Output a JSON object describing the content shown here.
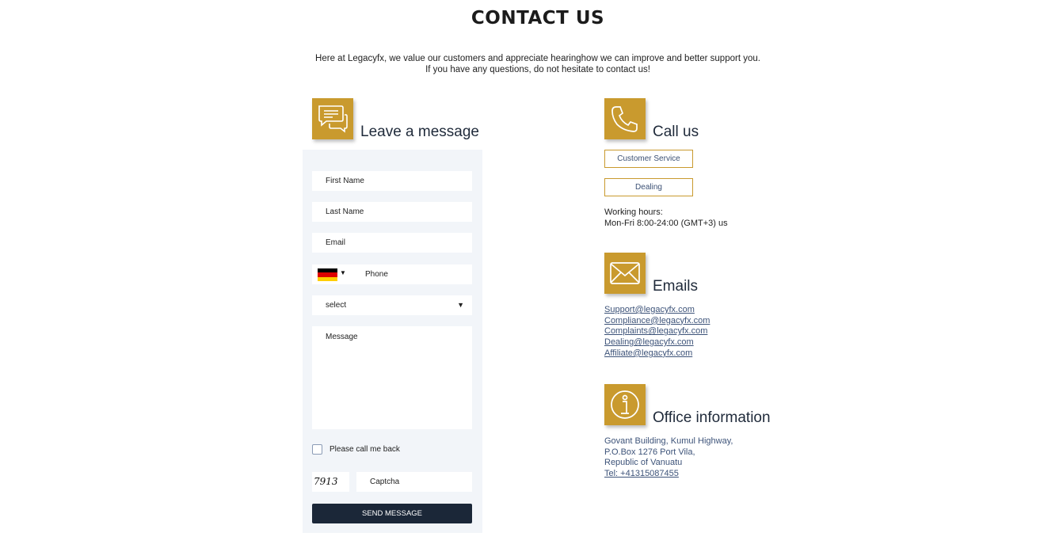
{
  "page": {
    "title": "CONTACT US",
    "intro_line1": "Here at Legacyfx, we value our customers and appreciate hearinghow we can improve and better support you.",
    "intro_line2": "If you have any questions, do not hesitate to contact us!"
  },
  "message_section": {
    "title": "Leave a message",
    "icon": "chat-bubbles-icon"
  },
  "form": {
    "first_name_placeholder": "First Name",
    "last_name_placeholder": "Last Name",
    "email_placeholder": "Email",
    "phone_placeholder": "Phone",
    "country_flag": "germany-flag-icon",
    "select_value": "select",
    "message_placeholder": "Message",
    "callback_label": "Please call me back",
    "callback_checked": false,
    "captcha_code": "7913",
    "captcha_placeholder": "Captcha",
    "send_label": "SEND MESSAGE"
  },
  "call_section": {
    "title": "Call us",
    "icon": "phone-icon",
    "customer_service_label": "Customer Service",
    "dealing_label": "Dealing",
    "hours_label": "Working hours:",
    "hours_value": "Mon-Fri 8:00-24:00 (GMT+3) us"
  },
  "email_section": {
    "title": "Emails",
    "icon": "envelope-icon",
    "emails": [
      "Support@legacyfx.com",
      "Compliance@legacyfx.com",
      "Complaints@legacyfx.com",
      "Dealing@legacyfx.com",
      "Affiliate@legacyfx.com"
    ]
  },
  "office_section": {
    "title": "Office information",
    "icon": "info-icon",
    "address_line1": "Govant Building, Kumul Highway,",
    "address_line2": "P.O.Box 1276 Port Vila,",
    "address_line3": "Republic of Vanuatu",
    "phone": "Tel: +41315087455"
  },
  "colors": {
    "accent_gold": "#c99a2e",
    "button_navy": "#1b2738",
    "link_blue": "#3d5379",
    "form_bg": "#f2f5f9"
  }
}
